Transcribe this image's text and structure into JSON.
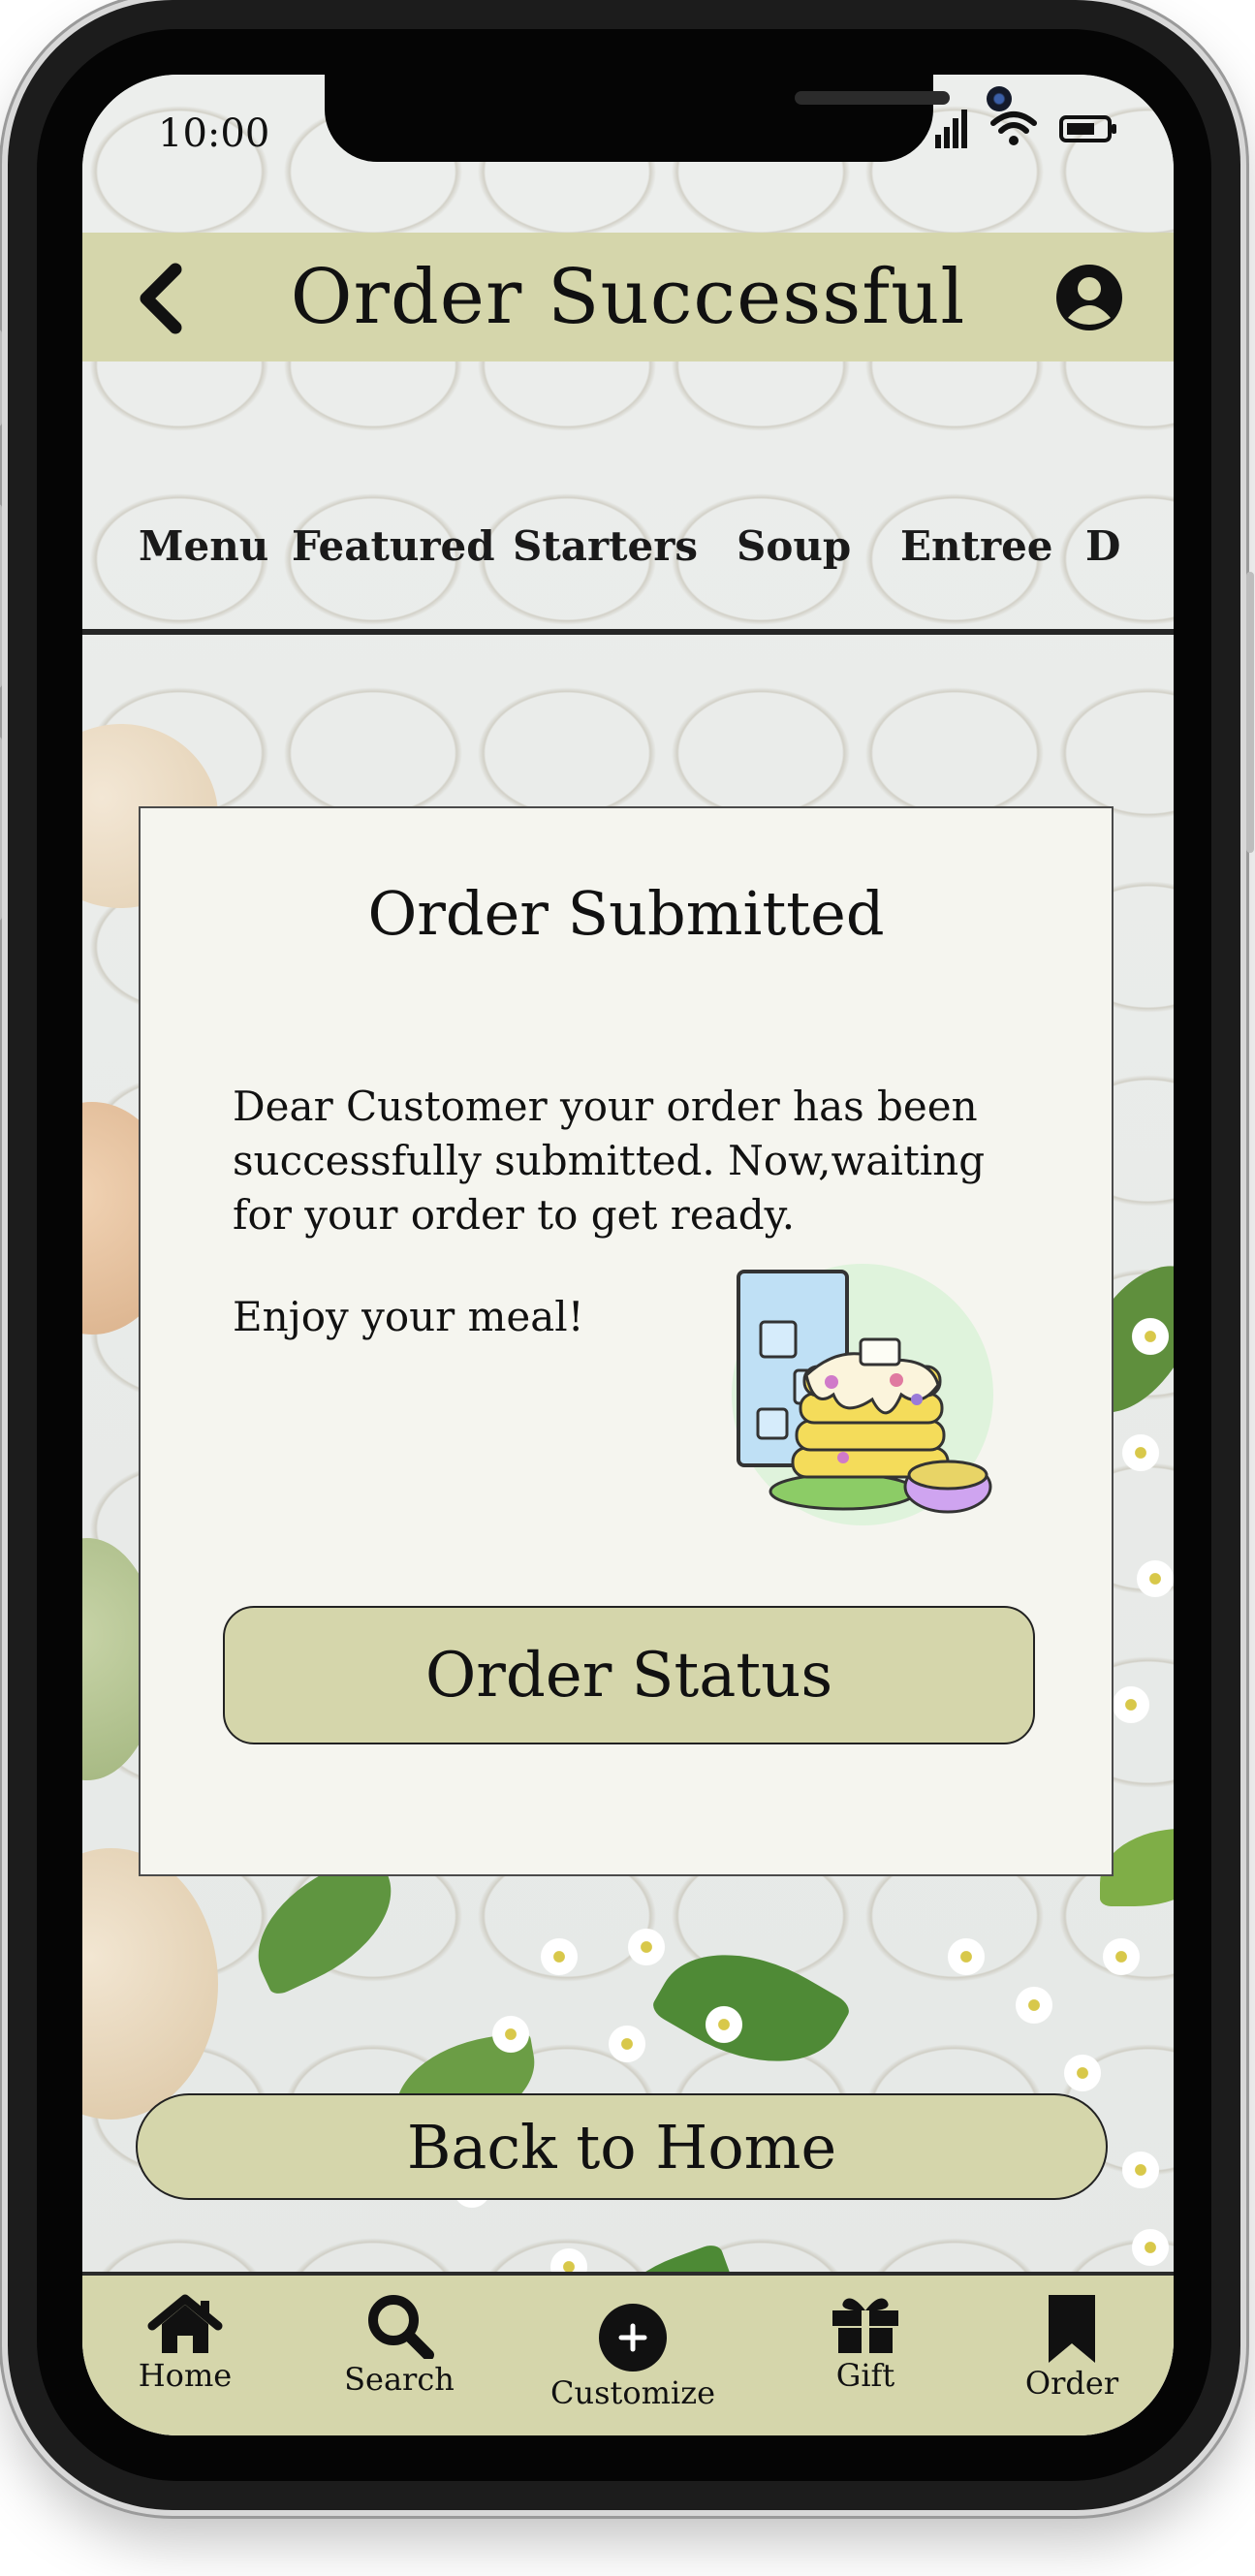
{
  "status_bar": {
    "time": "10:00"
  },
  "header": {
    "title": "Order Successful"
  },
  "tabs": [
    "Menu",
    "Featured",
    "Starters",
    "Soup",
    "Entree",
    "D"
  ],
  "card": {
    "title": "Order Submitted",
    "message": "Dear Customer your order has been successfully submitted. Now,waiting for your order to get ready.",
    "enjoy": "Enjoy your meal!",
    "button_label": "Order Status"
  },
  "back_home_label": "Back to Home",
  "bottom_nav": [
    {
      "label": "Home",
      "icon": "home-icon"
    },
    {
      "label": "Search",
      "icon": "search-icon"
    },
    {
      "label": "Customize",
      "icon": "plus-circle-icon"
    },
    {
      "label": "Gift",
      "icon": "gift-icon"
    },
    {
      "label": "Order",
      "icon": "bookmark-icon"
    }
  ],
  "colors": {
    "accent": "#d5d6ab",
    "card": "#f5f5ef"
  }
}
